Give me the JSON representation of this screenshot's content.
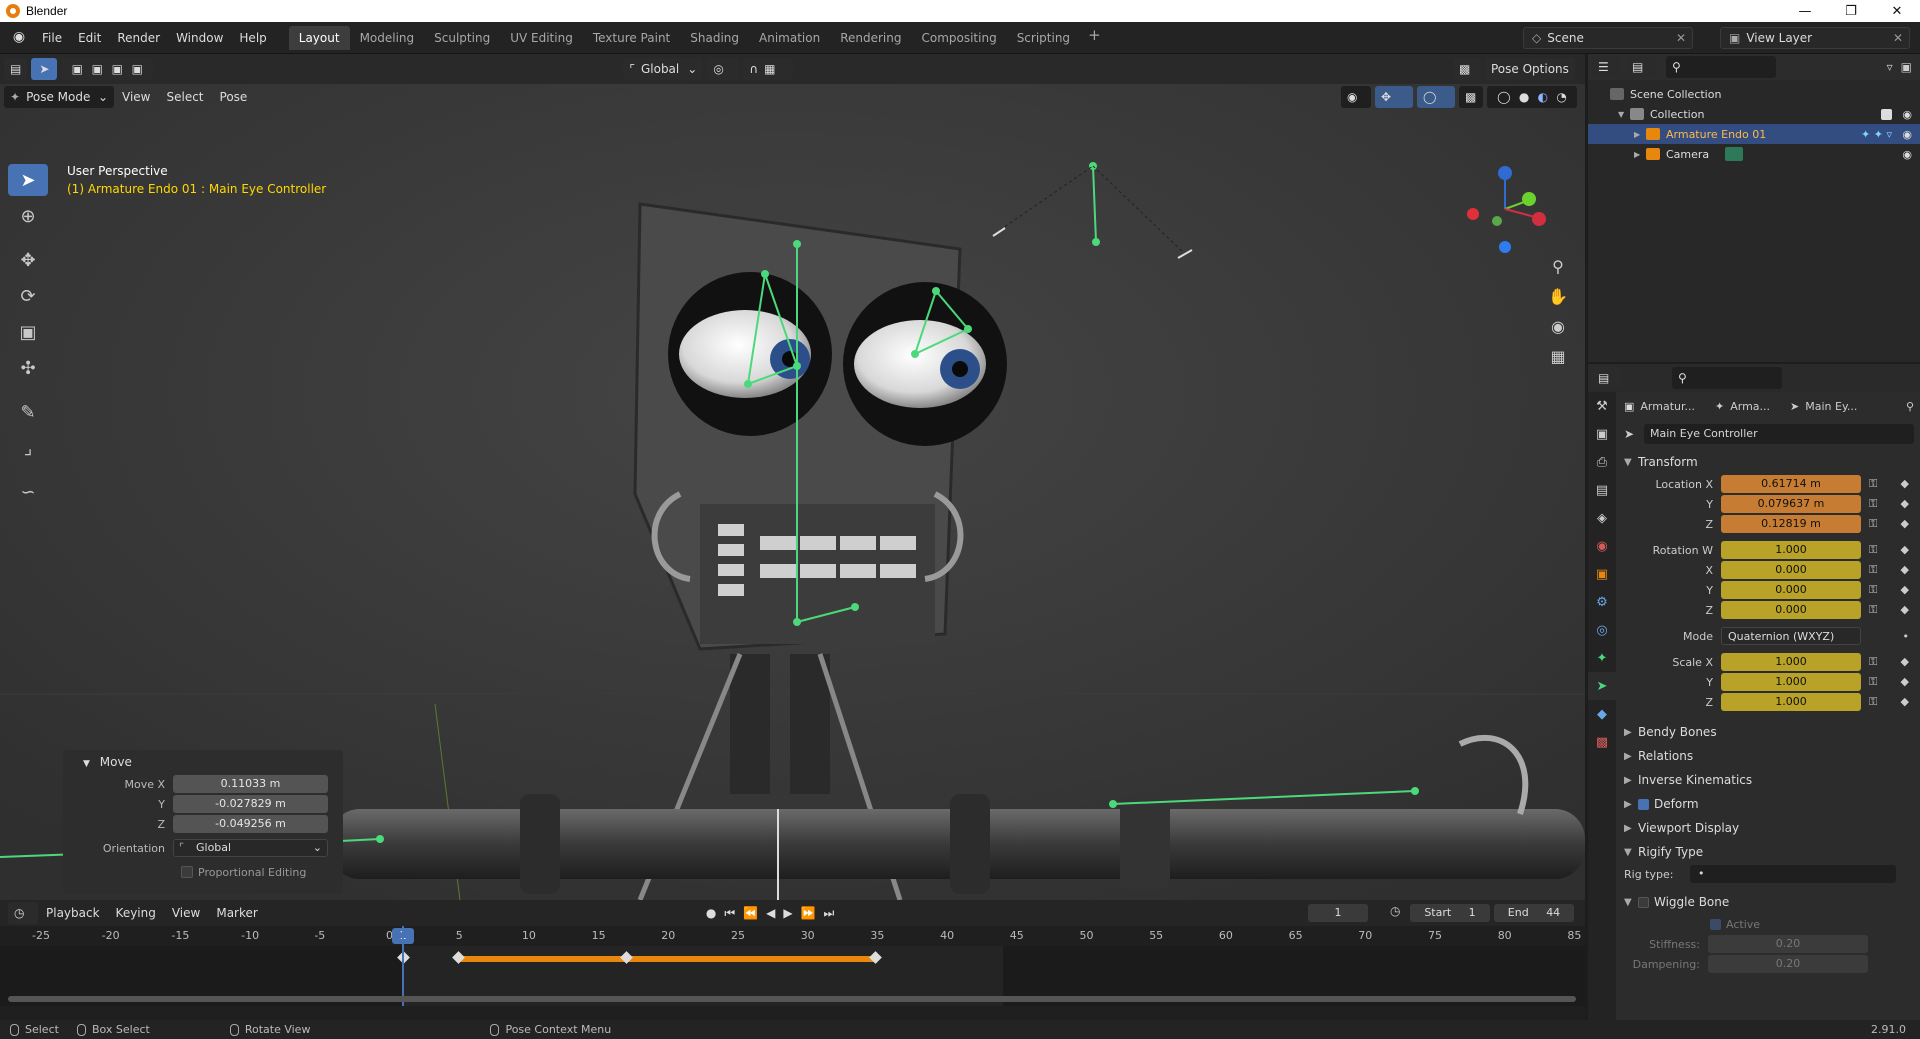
{
  "window": {
    "title": "Blender"
  },
  "menu": [
    "File",
    "Edit",
    "Render",
    "Window",
    "Help"
  ],
  "workspaces": [
    "Layout",
    "Modeling",
    "Sculpting",
    "UV Editing",
    "Texture Paint",
    "Shading",
    "Animation",
    "Rendering",
    "Compositing",
    "Scripting"
  ],
  "active_workspace": "Layout",
  "scene": {
    "name": "Scene",
    "view_layer": "View Layer"
  },
  "viewport": {
    "mode": "Pose Mode",
    "menus": [
      "View",
      "Select",
      "Pose"
    ],
    "orientation": "Global",
    "pose_options": "Pose Options",
    "perspective": "User Perspective",
    "active_object": "(1) Armature Endo 01 : Main Eye Controller"
  },
  "move_panel": {
    "title": "Move",
    "move_x": "0.11033 m",
    "y": "-0.027829 m",
    "z": "-0.049256 m",
    "labels": {
      "x": "Move X",
      "y": "Y",
      "z": "Z",
      "orientation": "Orientation",
      "proportional": "Proportional Editing"
    },
    "orientation": "Global"
  },
  "timeline": {
    "menus": [
      "Playback",
      "Keying",
      "View",
      "Marker"
    ],
    "current_frame": "1",
    "start_label": "Start",
    "start": "1",
    "end_label": "End",
    "end": "44",
    "ticks": [
      "-25",
      "-20",
      "-15",
      "-10",
      "-5",
      "0",
      "5",
      "10",
      "15",
      "20",
      "25",
      "30",
      "35",
      "40",
      "45",
      "50",
      "55",
      "60",
      "65",
      "70",
      "75",
      "80",
      "85"
    ],
    "playhead_label": "1"
  },
  "status": {
    "select": "Select",
    "box_select": "Box Select",
    "rotate_view": "Rotate View",
    "context_menu": "Pose Context Menu",
    "version": "2.91.0"
  },
  "outliner": {
    "root": "Scene Collection",
    "collection": "Collection",
    "items": [
      "Armature Endo 01",
      "Camera"
    ]
  },
  "properties": {
    "breadcrumb": [
      "Armatur...",
      "Arma...",
      "Main Ey..."
    ],
    "bone_name": "Main Eye Controller",
    "transform_title": "Transform",
    "location": {
      "label_x": "Location X",
      "x": "0.61714 m",
      "y": "0.079637 m",
      "z": "0.12819 m"
    },
    "rotation": {
      "label_w": "Rotation W",
      "w": "1.000",
      "x": "0.000",
      "y": "0.000",
      "z": "0.000"
    },
    "mode_label": "Mode",
    "mode": "Quaternion (WXYZ)",
    "scale": {
      "label_x": "Scale X",
      "x": "1.000",
      "y": "1.000",
      "z": "1.000"
    },
    "axis": {
      "y": "Y",
      "z": "Z",
      "x": "X"
    },
    "sections": [
      "Bendy Bones",
      "Relations",
      "Inverse Kinematics",
      "Deform",
      "Viewport Display",
      "Rigify Type"
    ],
    "rig_type_label": "Rig type:",
    "rig_type_value": "•",
    "wiggle": "Wiggle Bone",
    "active": "Active",
    "stiffness_label": "Stiffness:",
    "stiffness": "0.20",
    "dampening_label": "Dampening:",
    "dampening": "0.20"
  },
  "colors": {
    "accent": "#4772b3",
    "location_field": "#c67c33",
    "rotation_field": "#b8a227",
    "bone_green": "#4cd97b",
    "keyframe_orange": "#e8870e"
  }
}
